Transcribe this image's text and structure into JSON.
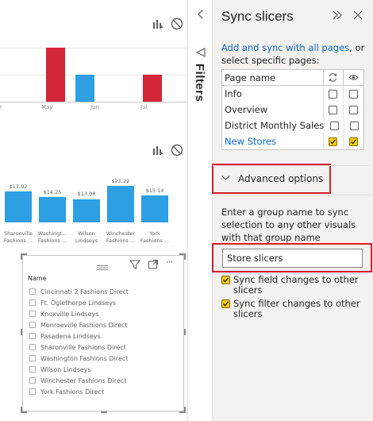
{
  "canvas": {
    "top_chart": {
      "months": [
        "May",
        "Jun",
        "Jul"
      ],
      "leading_tick_fragment": "r"
    },
    "store_chart": {
      "values": [
        "$17.92",
        "$14.25",
        "$13.08",
        "$21.22",
        "$15.14"
      ],
      "categories": [
        [
          "Sharonville",
          "Fashions ..."
        ],
        [
          "Washingt...",
          "Fashions ..."
        ],
        [
          "Wilson",
          "Lindseys"
        ],
        [
          "Winchester",
          "Fashions ..."
        ],
        [
          "York",
          "Fashions ..."
        ]
      ]
    },
    "slicer": {
      "field_name": "Name",
      "items": [
        "Cincinnati 2 Fashions Direct",
        "Ft. Oglethorpe Lindseys",
        "Knoxville Lindseys",
        "Monroeville Fashions Direct",
        "Pasadena Lindseys",
        "Sharonville Fashions Direct",
        "Washington Fashions Direct",
        "Wilson Lindseys",
        "Winchester Fashions Direct",
        "York Fashions Direct"
      ],
      "more_glyph": "···"
    }
  },
  "filters_pane": {
    "label": "Filters"
  },
  "sync_pane": {
    "title": "Sync slicers",
    "description_link": "Add and sync with all pages",
    "description_rest": ", or select specific pages:",
    "table": {
      "header": "Page name",
      "rows": [
        {
          "name": "Info",
          "sync": false,
          "visible": false
        },
        {
          "name": "Overview",
          "sync": false,
          "visible": false
        },
        {
          "name": "District Monthly Sales",
          "sync": false,
          "visible": false
        },
        {
          "name": "New Stores",
          "sync": true,
          "visible": true,
          "selected": true
        }
      ]
    },
    "advanced_label": "Advanced options",
    "group_description": "Enter a group name to sync selection to any other visuals with that group name",
    "group_value": "Store slicers",
    "options": [
      {
        "label": "Sync field changes to other slicers",
        "checked": true
      },
      {
        "label": "Sync filter changes to other slicers",
        "checked": true
      }
    ]
  },
  "colors": {
    "accent_red": "#d32637",
    "accent_blue": "#2d9fe2",
    "checkbox_on": "#f2c811",
    "highlight_box": "#d41f2c",
    "link": "#0b66c2"
  }
}
